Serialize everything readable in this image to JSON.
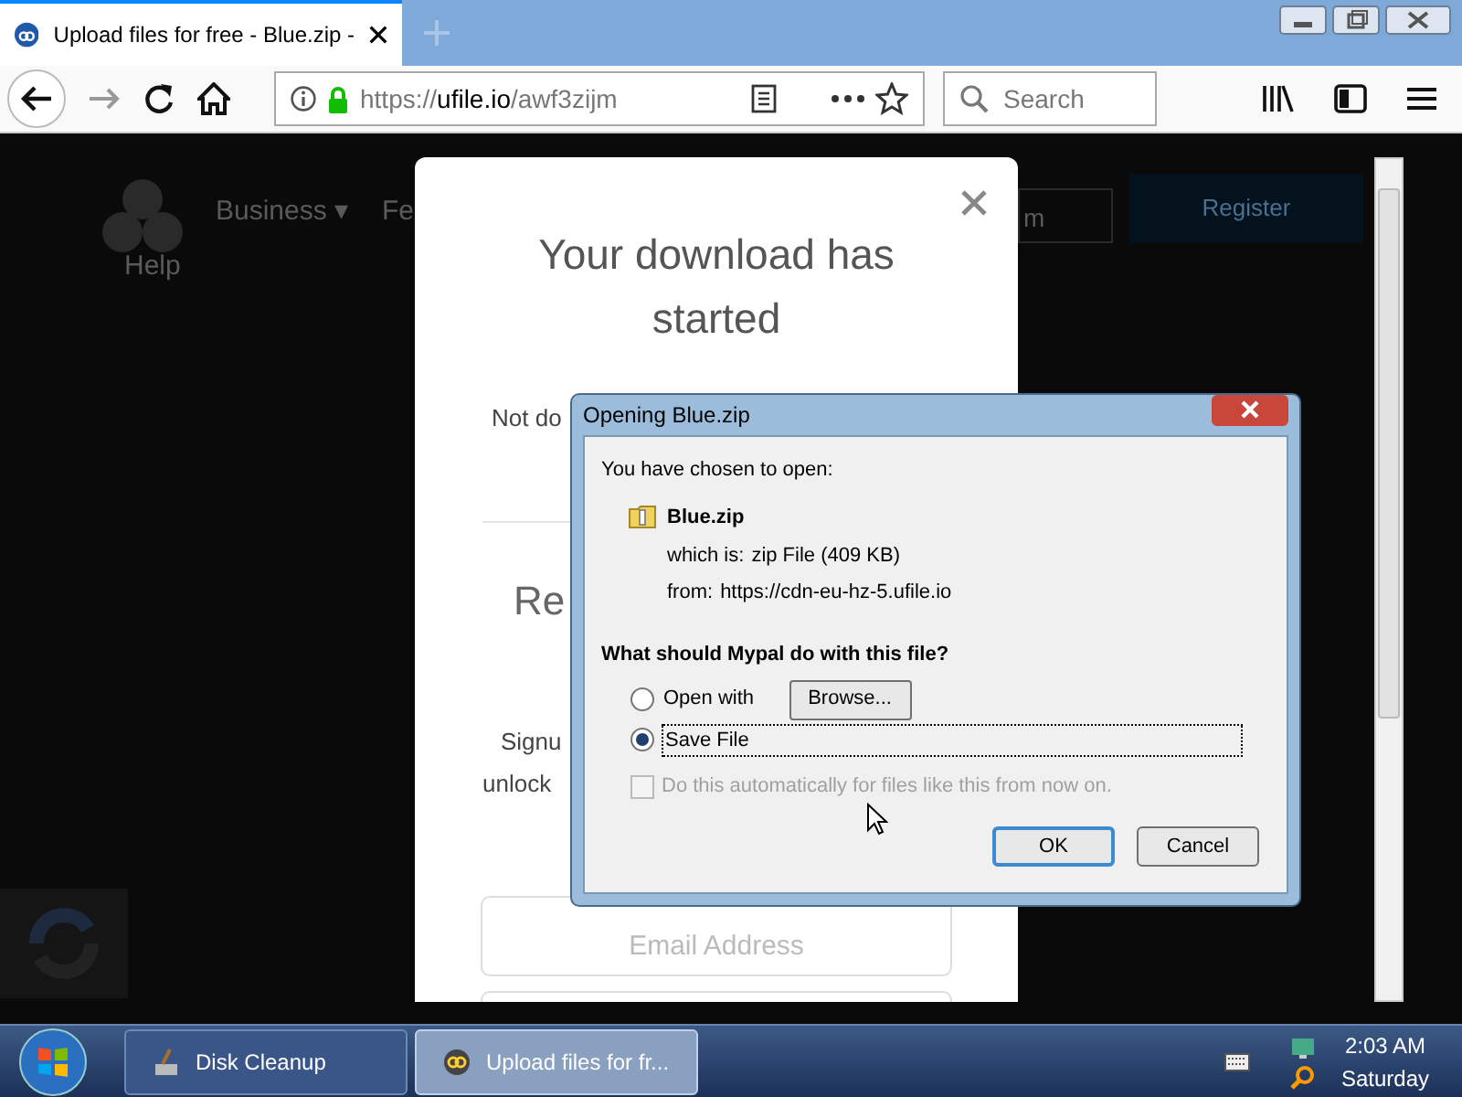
{
  "browser": {
    "tab": {
      "title": "Upload files for free - Blue.zip -"
    },
    "address": {
      "scheme": "https://",
      "host": "ufile.io",
      "path": "/awf3zijm"
    },
    "search": {
      "placeholder": "Search"
    }
  },
  "site": {
    "nav": [
      "Business ▾",
      "Fe"
    ],
    "logo_label": "Help",
    "register": "Register",
    "login_fragment": "m"
  },
  "modal": {
    "title": "Your download has started",
    "lines": [
      "Not do",
      "Re",
      "Signu",
      "unlock"
    ],
    "email": {
      "placeholder": "Email Address"
    }
  },
  "dialog": {
    "title": "Opening Blue.zip",
    "intro": "You have chosen to open:",
    "file": "Blue.zip",
    "which_is_label": "which is:",
    "which_is": "zip File (409 KB)",
    "from_label": "from:",
    "from": "https://cdn-eu-hz-5.ufile.io",
    "question": "What should Mypal do with this file?",
    "options": [
      {
        "label": "Open with",
        "selected": false
      },
      {
        "label": "Save File",
        "selected": true
      }
    ],
    "browse": "Browse...",
    "auto": {
      "label": "Do this automatically for files like this from now on.",
      "checked": false,
      "disabled": true
    },
    "buttons": [
      "OK",
      "Cancel"
    ]
  },
  "taskbar": {
    "items": [
      {
        "label": "Disk Cleanup",
        "selected": false
      },
      {
        "label": "Upload files for fr...",
        "selected": true
      }
    ],
    "time": "2:03 AM",
    "day": "Saturday"
  }
}
